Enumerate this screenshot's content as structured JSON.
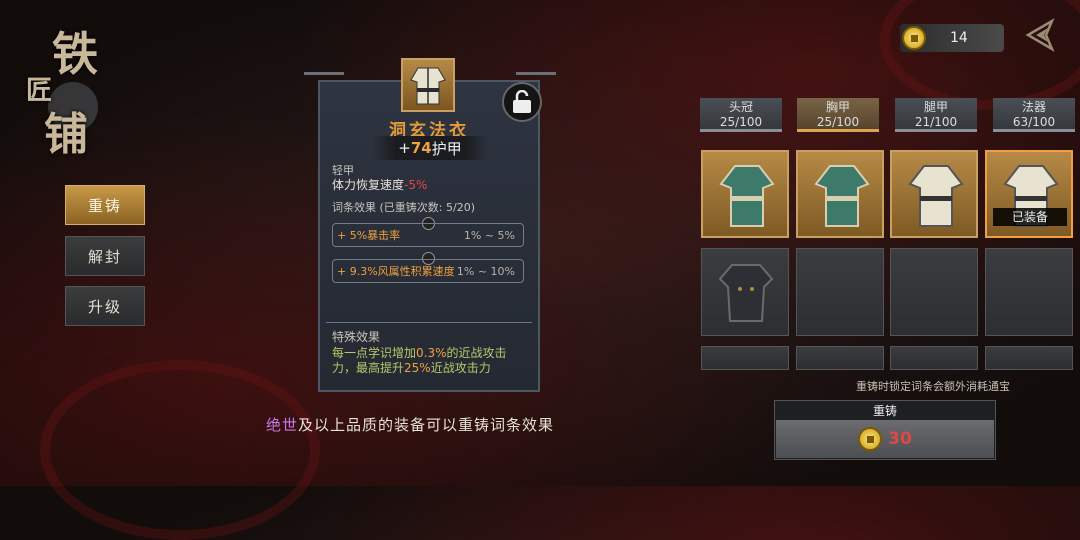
{
  "logo": {
    "c1": "铁",
    "c2": "匠",
    "c3": "铺"
  },
  "side_menu": [
    {
      "label": "重铸",
      "active": true
    },
    {
      "label": "解封",
      "active": false
    },
    {
      "label": "升级",
      "active": false
    }
  ],
  "currency": {
    "amount": "14",
    "icon": "gold-coin-icon"
  },
  "item": {
    "name": "洞玄法衣",
    "armor_prefix": "+",
    "armor_value": "74",
    "armor_label": "护甲",
    "type": "轻甲",
    "penalty_label": "体力恢复速度",
    "penalty_value": "-5%",
    "affix_header": "词条效果 (已重铸次数: 5/20)",
    "affixes": [
      {
        "text": "+ 5%暴击率",
        "range": "1% ~ 5%"
      },
      {
        "text": "+ 9.3%风属性积累速度",
        "range": "1% ~ 10%"
      }
    ],
    "special_title": "特殊效果",
    "special_a": "每一点学识增加",
    "special_b": "0.3%",
    "special_c": "的近战攻击力，最高提升",
    "special_d": "25%",
    "special_e": "近战攻击力"
  },
  "note": {
    "highlight": "绝世",
    "rest": "及以上品质的装备可以重铸词条效果"
  },
  "tabs": [
    {
      "name": "头冠",
      "count": "25/100",
      "active": false
    },
    {
      "name": "胸甲",
      "count": "25/100",
      "active": true
    },
    {
      "name": "腿甲",
      "count": "21/100",
      "active": false
    },
    {
      "name": "法器",
      "count": "63/100",
      "active": false
    }
  ],
  "equipped_tag": "已装备",
  "hint": "重铸时锁定词条会额外消耗通宝",
  "reforge": {
    "label": "重铸",
    "cost": "30"
  },
  "colors": {
    "accent": "#f0a040",
    "negative": "#e04848",
    "special": "#b8c86a",
    "purple": "#c77ae8"
  }
}
